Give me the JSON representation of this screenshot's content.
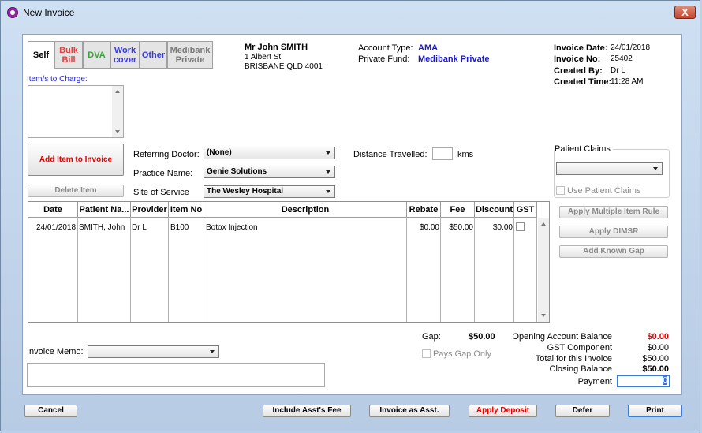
{
  "window": {
    "title": "New Invoice",
    "close_label": "X"
  },
  "tabs": [
    {
      "label": "Self",
      "color": "#000000"
    },
    {
      "label": "Bulk Bill",
      "color": "#e04040"
    },
    {
      "label": "DVA",
      "color": "#3aa23a"
    },
    {
      "label": "Work cover",
      "color": "#3a3ae0"
    },
    {
      "label": "Other",
      "color": "#3a3ae0"
    },
    {
      "label": "Medibank Private",
      "color": "#7a7a7a"
    }
  ],
  "items_to_charge_label": "Item/s to Charge:",
  "patient": {
    "name": "Mr John SMITH",
    "address1": "1 Albert St",
    "address2": "BRISBANE QLD 4001"
  },
  "account": {
    "type_label": "Account Type:",
    "type_value": "AMA",
    "fund_label": "Private Fund:",
    "fund_value": "Medibank Private"
  },
  "invoice_info": {
    "date_label": "Invoice Date:",
    "date_value": "24/01/2018",
    "no_label": "Invoice No:",
    "no_value": "25402",
    "created_by_label": "Created By:",
    "created_by_value": "Dr L",
    "created_time_label": "Created Time:",
    "created_time_value": "11:28 AM"
  },
  "buttons": {
    "add_item": "Add Item to Invoice",
    "delete_item": "Delete Item",
    "apply_multiple": "Apply Multiple Item Rule",
    "apply_dimsr": "Apply DIMSR",
    "add_known_gap": "Add Known Gap",
    "cancel": "Cancel",
    "include_asst": "Include Asst's Fee",
    "invoice_asst": "Invoice as Asst.",
    "apply_deposit": "Apply Deposit",
    "defer": "Defer",
    "print": "Print"
  },
  "form": {
    "referring_label": "Referring Doctor:",
    "referring_value": "(None)",
    "practice_label": "Practice Name:",
    "practice_value": "Genie Solutions",
    "site_label": "Site of Service",
    "site_value": "The Wesley Hospital",
    "distance_label": "Distance Travelled:",
    "distance_value": "",
    "distance_unit": "kms"
  },
  "patient_claims": {
    "label": "Patient Claims",
    "selected": "",
    "use_label": "Use Patient Claims"
  },
  "table": {
    "columns": [
      "Date",
      "Patient Na...",
      "Provider",
      "Item No",
      "Description",
      "Rebate",
      "Fee",
      "Discount",
      "GST"
    ],
    "rows": [
      {
        "date": "24/01/2018",
        "patient": "SMITH, John",
        "provider": "Dr L",
        "item": "B100",
        "description": "Botox Injection",
        "rebate": "$0.00",
        "fee": "$50.00",
        "discount": "$0.00"
      }
    ]
  },
  "gap": {
    "label": "Gap:",
    "value": "$50.00",
    "pays_gap_label": "Pays Gap Only"
  },
  "totals": {
    "opening_label": "Opening Account Balance",
    "opening_value": "$0.00",
    "gst_label": "GST Component",
    "gst_value": "$0.00",
    "total_label": "Total for this Invoice",
    "total_value": "$50.00",
    "closing_label": "Closing Balance",
    "closing_value": "$50.00",
    "payment_label": "Payment",
    "payment_value": "0"
  },
  "memo": {
    "label": "Invoice Memo:",
    "selected": "",
    "text": ""
  },
  "colors": {
    "accent_red": "#e00000",
    "accent_blue": "#1a1ad0"
  }
}
